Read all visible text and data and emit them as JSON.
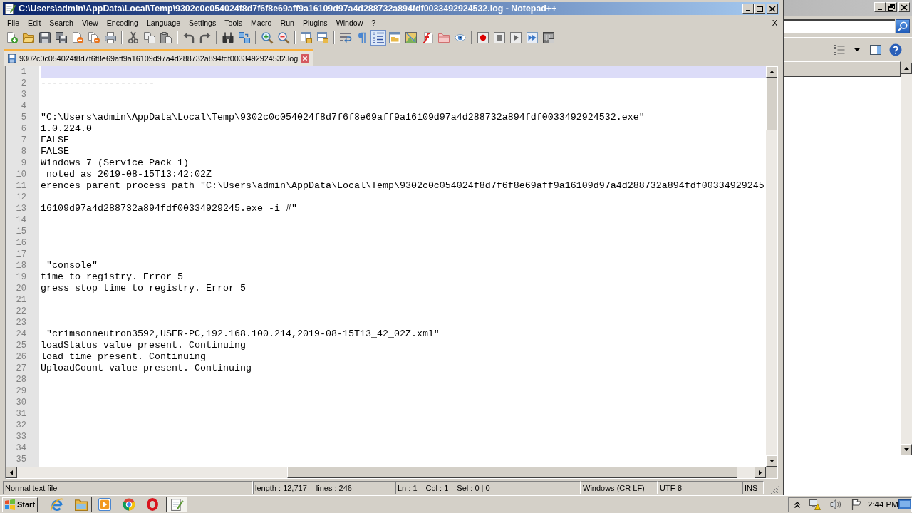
{
  "window": {
    "title": "C:\\Users\\admin\\AppData\\Local\\Temp\\9302c0c054024f8d7f6f8e69aff9a16109d97a4d288732a894fdf0033492924532.log - Notepad++"
  },
  "menu": {
    "items": [
      "File",
      "Edit",
      "Search",
      "View",
      "Encoding",
      "Language",
      "Settings",
      "Tools",
      "Macro",
      "Run",
      "Plugins",
      "Window",
      "?"
    ],
    "close_label": "X"
  },
  "toolbar": {
    "groups": [
      [
        {
          "kind": "new",
          "pressed": false
        },
        {
          "kind": "open",
          "pressed": false
        },
        {
          "kind": "save",
          "pressed": false
        },
        {
          "kind": "save_all",
          "pressed": false
        },
        {
          "kind": "close",
          "pressed": false
        },
        {
          "kind": "close_all",
          "pressed": false
        },
        {
          "kind": "print",
          "pressed": false
        }
      ],
      [
        {
          "kind": "cut",
          "pressed": false
        },
        {
          "kind": "copy",
          "pressed": false
        },
        {
          "kind": "paste",
          "pressed": false
        }
      ],
      [
        {
          "kind": "undo",
          "pressed": false
        },
        {
          "kind": "redo",
          "pressed": false
        }
      ],
      [
        {
          "kind": "find",
          "pressed": false
        },
        {
          "kind": "replace",
          "pressed": false
        }
      ],
      [
        {
          "kind": "zoom_in",
          "pressed": false
        },
        {
          "kind": "zoom_out",
          "pressed": false
        }
      ],
      [
        {
          "kind": "sync_v",
          "pressed": false
        },
        {
          "kind": "sync_h",
          "pressed": false
        }
      ],
      [
        {
          "kind": "wrap",
          "pressed": false
        },
        {
          "kind": "all_chars",
          "pressed": false
        },
        {
          "kind": "indent_guide",
          "pressed": true
        },
        {
          "kind": "udl",
          "pressed": false
        },
        {
          "kind": "doc_map",
          "pressed": false
        },
        {
          "kind": "func_list",
          "pressed": false
        },
        {
          "kind": "folder_ws",
          "pressed": false
        },
        {
          "kind": "monitor",
          "pressed": false
        }
      ],
      [
        {
          "kind": "record",
          "pressed": false
        },
        {
          "kind": "stop",
          "pressed": false
        },
        {
          "kind": "play",
          "pressed": false
        },
        {
          "kind": "play_multi",
          "pressed": false
        },
        {
          "kind": "save_macro",
          "pressed": false
        }
      ]
    ]
  },
  "tabs": [
    {
      "label": "9302c0c054024f8d7f6f8e69aff9a16109d97a4d288732a894fdf0033492924532.log",
      "selected": true
    }
  ],
  "editor": {
    "lines": [
      {
        "number": "1",
        "current": true
      },
      {
        "number": "2",
        "text": "--------------------",
        "current": false
      },
      {
        "number": "3",
        "current": false
      },
      {
        "number": "4",
        "current": false
      },
      {
        "number": "5",
        "text": "\"C:\\Users\\admin\\AppData\\Local\\Temp\\9302c0c054024f8d7f6f8e69aff9a16109d97a4d288732a894fdf0033492924532.exe\"",
        "current": false
      },
      {
        "number": "6",
        "text": "1.0.224.0",
        "current": false
      },
      {
        "number": "7",
        "text": "FALSE",
        "current": false
      },
      {
        "number": "8",
        "text": "FALSE",
        "current": false
      },
      {
        "number": "9",
        "text": "Windows 7 (Service Pack 1)",
        "current": false
      },
      {
        "number": "10",
        "text": " noted as 2019-08-15T13:42:02Z",
        "current": false
      },
      {
        "number": "11",
        "text": "erences parent process path \"C:\\Users\\admin\\AppData\\Local\\Temp\\9302c0c054024f8d7f6f8e69aff9a16109d97a4d288732a894fdf00334929245",
        "current": false
      },
      {
        "number": "12",
        "current": false
      },
      {
        "number": "13",
        "text": "16109d97a4d288732a894fdf00334929245.exe -i #\"",
        "current": false
      },
      {
        "number": "14",
        "current": false
      },
      {
        "number": "15",
        "current": false
      },
      {
        "number": "16",
        "current": false
      },
      {
        "number": "17",
        "current": false
      },
      {
        "number": "18",
        "text": " \"console\"",
        "current": false
      },
      {
        "number": "19",
        "text": "time to registry. Error 5",
        "current": false
      },
      {
        "number": "20",
        "text": "gress stop time to registry. Error 5",
        "current": false
      },
      {
        "number": "21",
        "current": false
      },
      {
        "number": "22",
        "current": false
      },
      {
        "number": "23",
        "current": false
      },
      {
        "number": "24",
        "text": " \"crimsonneutron3592,USER-PC,192.168.100.214,2019-08-15T13_42_02Z.xml\"",
        "current": false
      },
      {
        "number": "25",
        "text": "loadStatus value present. Continuing",
        "current": false
      },
      {
        "number": "26",
        "text": "load time present. Continuing",
        "current": false
      },
      {
        "number": "27",
        "text": "UploadCount value present. Continuing",
        "current": false
      },
      {
        "number": "28",
        "current": false
      },
      {
        "number": "29",
        "current": false
      },
      {
        "number": "30",
        "current": false
      },
      {
        "number": "31",
        "current": false
      },
      {
        "number": "32",
        "current": false
      },
      {
        "number": "33",
        "current": false
      },
      {
        "number": "34",
        "current": false
      },
      {
        "number": "35",
        "current": false
      }
    ]
  },
  "status_bar": {
    "file_type": "Normal text file",
    "length": "length : 12,717",
    "lines": "lines : 246",
    "line": "Ln : 1",
    "column": "Col : 1",
    "selection": "Sel : 0 | 0",
    "eol": "Windows (CR LF)",
    "encoding": "UTF-8",
    "mode": "INS"
  },
  "taskbar": {
    "start_label": "Start",
    "items": [
      {
        "kind": "browser",
        "open": false,
        "selected": false
      },
      {
        "kind": "folder",
        "open": true,
        "selected": false
      },
      {
        "kind": "player",
        "open": false,
        "selected": false
      },
      {
        "kind": "wheel",
        "open": false,
        "selected": false
      },
      {
        "kind": "ring",
        "open": false,
        "selected": false
      },
      {
        "kind": "notepad",
        "open": true,
        "selected": true
      }
    ],
    "clock": "2:44 PM"
  }
}
